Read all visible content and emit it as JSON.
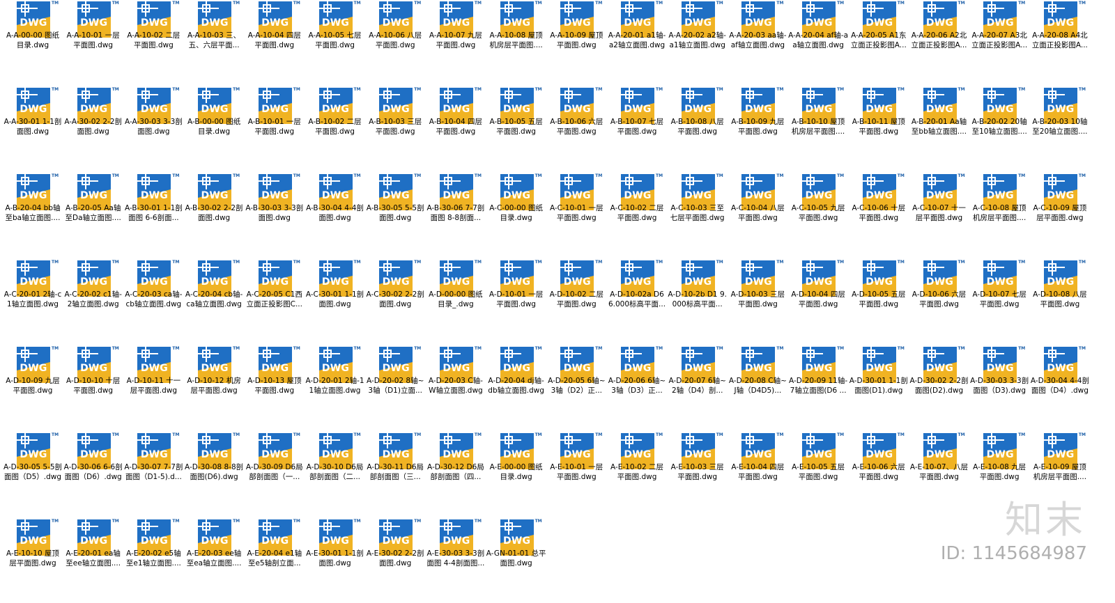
{
  "files": [
    "A-A-00-00 图纸目录.dwg",
    "A-A-10-01 一层平面图.dwg",
    "A-A-10-02 二层平面图.dwg",
    "A-A-10-03 三、五、六层平面...",
    "A-A-10-04 四层平面图.dwg",
    "A-A-10-05 七层平面图.dwg",
    "A-A-10-06 八层平面图.dwg",
    "A-A-10-07 九层平面图.dwg",
    "A-A-10-08 屋顶机房层平面图....",
    "A-A-10-09 屋顶平面图.dwg",
    "A-A-20-01 a1轴-a2轴立面图.dwg",
    "A-A-20-02 a2轴-a1轴立面图.dwg",
    "A-A-20-03 aa轴-af轴立面图.dwg",
    "A-A-20-04 af轴-aa轴立面图.dwg",
    "A-A-20-05 A1东立面正投影图A...",
    "A-A-20-06 A2北立面正投影图A...",
    "A-A-20-07 A3北立面正投影图A...",
    "A-A-20-08 A4北立面正投影图A...",
    "A-A-30-01 1-1剖面图.dwg",
    "A-A-30-02 2-2剖面图.dwg",
    "A-A-30-03 3-3剖面图.dwg",
    "A-B-00-00 图纸目录.dwg",
    "A-B-10-01 一层平面图.dwg",
    "A-B-10-02 二层平面图.dwg",
    "A-B-10-03 三层平面图.dwg",
    "A-B-10-04 四层平面图.dwg",
    "A-B-10-05 五层平面图.dwg",
    "A-B-10-06 六层平面图.dwg",
    "A-B-10-07 七层平面图.dwg",
    "A-B-10-08 八层平面图.dwg",
    "A-B-10-09 九层平面图.dwg",
    "A-B-10-10 屋顶机房层平面图....",
    "A-B-10-11 屋顶平面图.dwg",
    "A-B-20-01 Aa轴至bb轴立面图....",
    "A-B-20-02 20轴至10轴立面图....",
    "A-B-20-03 10轴至20轴立面图....",
    "A-B-20-04 bb轴至ba轴立面图....",
    "A-B-20-05 Aa轴至Da轴立面图....",
    "A-B-30-01 1-1剖面图 6-6剖面...",
    "A-B-30-02 2-2剖面图.dwg",
    "A-B-30-03 3-3剖面图.dwg",
    "A-B-30-04 4-4剖面图.dwg",
    "A-B-30-05 5-5剖面图.dwg",
    "A-B-30-06 7-7剖面图 8-8剖面...",
    "A-C-00-00 图纸目录.dwg",
    "A-C-10-01 一层平面图.dwg",
    "A-C-10-02 二层平面图.dwg",
    "A-C-10-03 三至七层平面图.dwg",
    "A-C-10-04 八层平面图.dwg",
    "A-C-10-05 九层平面图.dwg",
    "A-C-10-06 十层平面图.dwg",
    "A-C-10-07 十一层平面图.dwg",
    "A-C-10-08 屋顶机房层平面图....",
    "A-C-10-09 屋顶层平面图.dwg",
    "A-C-20-01 2轴-c1轴立面图.dwg",
    "A-C-20-02 c1轴-2轴立面图.dwg",
    "A-C-20-03 ca轴-cb轴立面图.dwg",
    "A-C-20-04 cb轴-ca轴立面图.dwg",
    "A-C-20-05 C1西立面正投影图C...",
    "A-C-30-01 1-1剖面图.dwg",
    "A-C-30-02 2-2剖面图.dwg",
    "A-D-00-00 图纸目录_.dwg",
    "A-D-10-01 一层平面图.dwg",
    "A-D-10-02 二层平面图.dwg",
    "A-D-10-02a D6 6.000标高平面...",
    "A-D-10-2b D1 9.000标高平面...",
    "A-D-10-03 三层平面图.dwg",
    "A-D-10-04 四层平面图.dwg",
    "A-D-10-05 五层平面图.dwg",
    "A-D-10-06 六层平面图.dwg",
    "A-D-10-07 七层平面图.dwg",
    "A-D-10-08 八层平面图.dwg",
    "A-D-10-09 九层平面图.dwg",
    "A-D-10-10 十层平面图.dwg",
    "A-D-10-11 十一层平面图.dwg",
    "A-D-10-12 机房层平面图.dwg",
    "A-D-10-13 屋顶平面图.dwg",
    "A-D-20-01 2轴-11轴立面图.dwg",
    "A-D-20-02 8轴~3轴（D1)立面...",
    "A-D-20-03 C轴-W轴立面图.dwg",
    "A-D-20-04 dj轴-db轴立面图.dwg",
    "A-D-20-05 6轴~3轴（D2）正...",
    "A-D-20-06 6轴~3轴（D3）正...",
    "A-D-20-07 6轴~2轴（D4）剖...",
    "A-D-20-08 C轴~J轴（D4D5)...",
    "A-D-20-09 11轴-7轴立面图(D6 ...",
    "A-D-30-01 1-1剖面图(D1).dwg",
    "A-D-30-02 2-2剖面图(D2).dwg",
    "A-D-30-03 3-3剖面图（D3).dwg",
    "A-D-30-04 4-4剖面图（D4）.dwg",
    "A-D-30-05 5-5剖面图（D5）.dwg",
    "A-D-30-06 6-6剖面图（D6）.dwg",
    "A-D-30-07 7-7剖面图（D1-5).d...",
    "A-D-30-08 8-8剖面图(D6).dwg",
    "A-D-30-09 D6局部剖面图（一...",
    "A-D-30-10 D6局部剖面图（二...",
    "A-D-30-11 D6局部剖面图（三...",
    "A-D-30-12 D6局部剖面图（四...",
    "A-E-00-00 图纸目录.dwg",
    "A-E-10-01 一层平面图.dwg",
    "A-E-10-02 二层平面图.dwg",
    "A-E-10-03 三层平面图.dwg",
    "A-E-10-04 四层平面图.dwg",
    "A-E-10-05 五层平面图.dwg",
    "A-E-10-06 六层平面图.dwg",
    "A-E-10-07、八层平面图.dwg",
    "A-E-10-08 九层平面图.dwg",
    "A-E-10-09 屋顶机房层平面图....",
    "A-E-10-10 屋顶层平面图.dwg",
    "A-E-20-01 ea轴至ee轴立面图....",
    "A-E-20-02 e5轴至e1轴立面图....",
    "A-E-20-03 ee轴至ea轴立面图....",
    "A-E-20-04 e1轴至e5轴剖立面...",
    "A-E-30-01 1-1剖面图.dwg",
    "A-E-30-02 2-2剖面图.dwg",
    "A-E-30-03 3-3剖面图 4-4剖面图...",
    "A-GN-01-01 总平面图.dwg"
  ],
  "icon": {
    "name": "dwg-file-icon",
    "text": "DWG",
    "tm": "TM",
    "blue": "#1f6fc4",
    "yellow": "#f0b323"
  },
  "watermark": {
    "logo": "知末",
    "id": "ID: 1145684987"
  }
}
